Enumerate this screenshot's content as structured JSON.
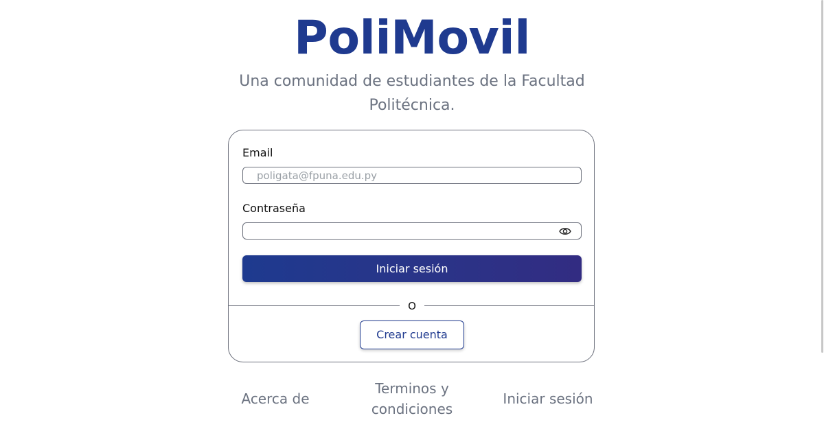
{
  "brand": {
    "title": "PoliMovil"
  },
  "tagline": "Una comunidad de estudiantes de la Facultad Politécnica.",
  "login_form": {
    "email_label": "Email",
    "email_placeholder": "poligata@fpuna.edu.py",
    "email_value": "",
    "password_label": "Contraseña",
    "password_value": "",
    "toggle_icon": "eye-icon",
    "submit_label": "Iniciar sesión",
    "divider_text": "O",
    "create_account_label": "Crear cuenta"
  },
  "footer": {
    "links": [
      "Acerca de",
      "Terminos y condiciones",
      "Iniciar sesión"
    ]
  },
  "colors": {
    "brand": "#1f3a8f",
    "button_gradient_start": "#1e3a8f",
    "button_gradient_end": "#322c82",
    "muted_text": "#6b7280",
    "border": "#6b6f7b"
  }
}
